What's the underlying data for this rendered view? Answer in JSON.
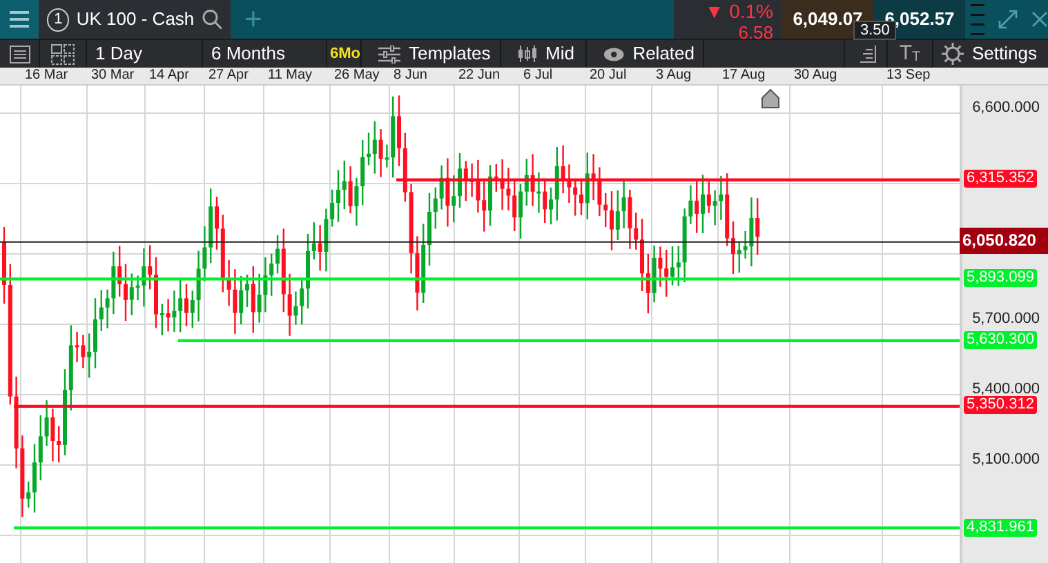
{
  "top_bar": {
    "tab": {
      "number": "1",
      "title": "UK 100 - Cash"
    },
    "add": "+",
    "change": {
      "arrow": "▼",
      "percent": "0.1%",
      "points": "6.58"
    },
    "sell": "6,049.07",
    "buy": "6,052.57",
    "spread": "3.50"
  },
  "toolbar": {
    "interval": "1 Day",
    "range": "6 Months",
    "range_badge": "6Mo",
    "templates": "Templates",
    "price_type": "Mid",
    "related": "Related",
    "text_size": "TT",
    "settings": "Settings"
  },
  "chart": {
    "x_labels": [
      "16 Mar",
      "30 Mar",
      "14 Apr",
      "27 Apr",
      "11 May",
      "26 May",
      "8 Jun",
      "22 Jun",
      "6 Jul",
      "20 Jul",
      "3 Aug",
      "17 Aug",
      "30 Aug",
      "13 Sep"
    ],
    "y_labels": [
      "6,600.000",
      "5,700.000",
      "5,400.000",
      "5,100.000"
    ],
    "price_lines": [
      {
        "label": "6,315.352",
        "color": "#ff0a23"
      },
      {
        "label": "5,893.099",
        "color": "#00f02d"
      },
      {
        "label": "5,630.300",
        "color": "#00f02d"
      },
      {
        "label": "5,350.312",
        "color": "#ff0a23"
      },
      {
        "label": "4,831.961",
        "color": "#00f02d"
      }
    ],
    "current_price": "6,050.820"
  }
}
